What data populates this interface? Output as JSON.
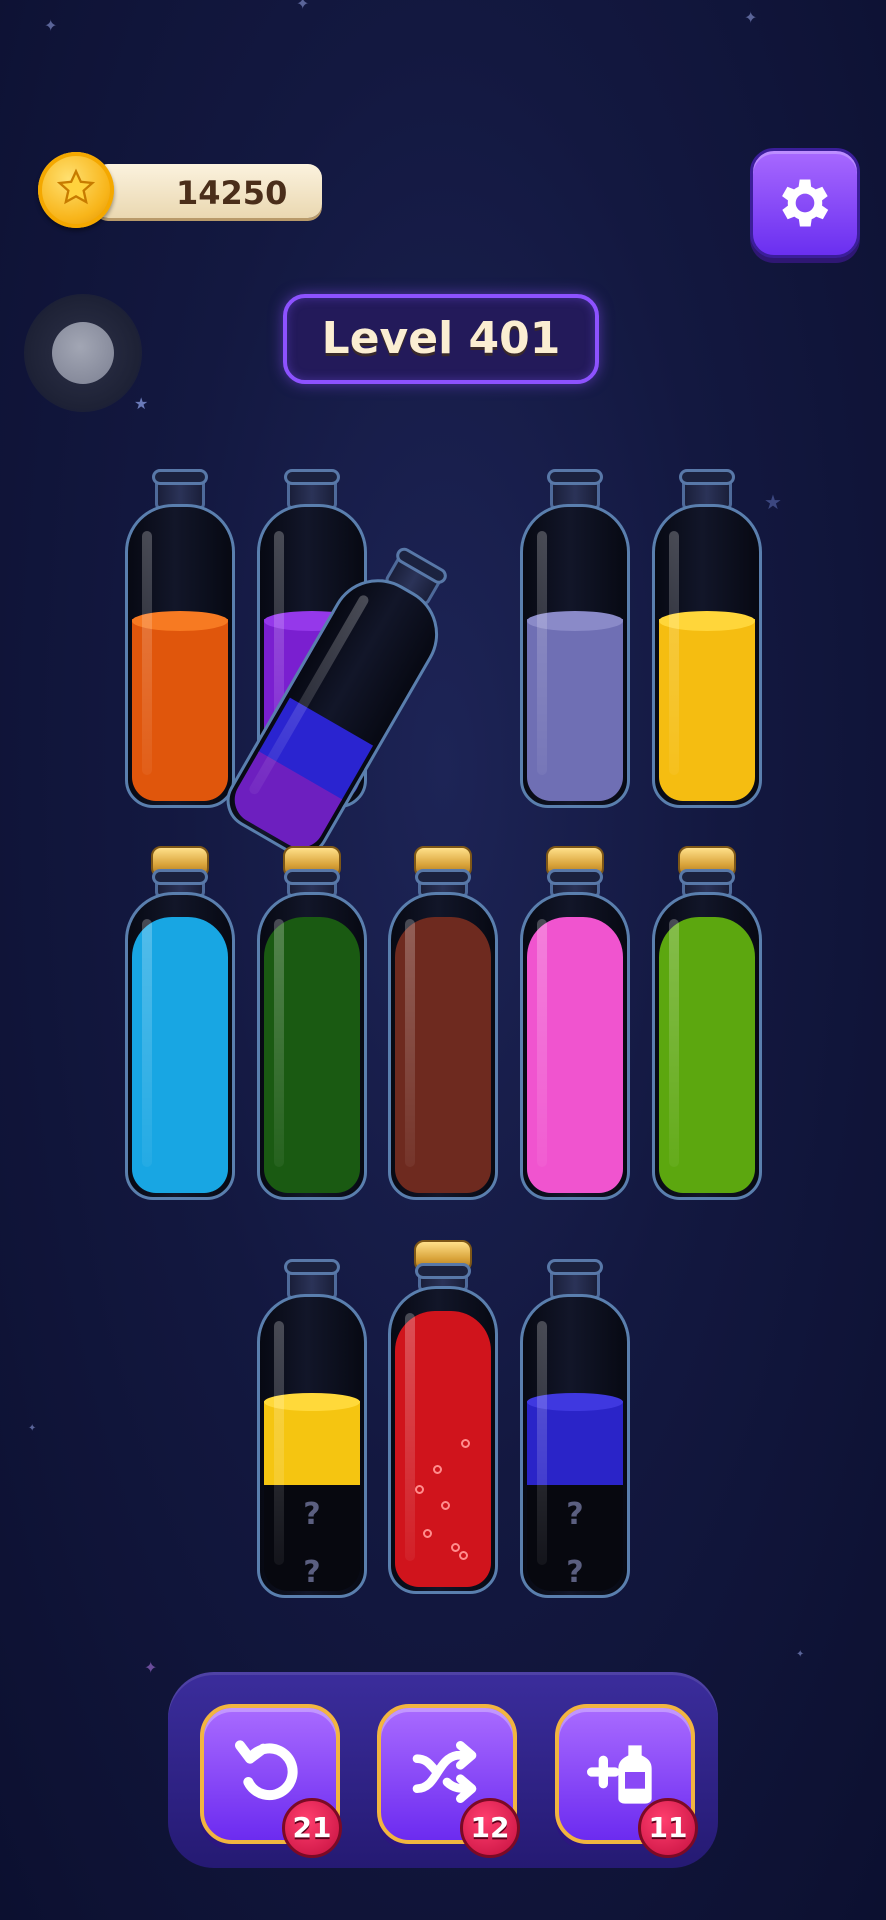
{
  "coins": {
    "value": "14250",
    "icon": "star-coin-icon"
  },
  "level": {
    "label": "Level 401"
  },
  "settings": {
    "icon": "gear-icon"
  },
  "bottles": {
    "row1": [
      {
        "name": "bottle-orange",
        "layers": [
          {
            "color": "#e0560c"
          }
        ]
      },
      {
        "name": "bottle-purple-blue",
        "layers": [
          {
            "color": "#7a1fd0"
          },
          {
            "color": "#2a24d0"
          }
        ]
      },
      {
        "name": "bottle-lavender",
        "layers": [
          {
            "color": "#6f6fb4"
          }
        ]
      },
      {
        "name": "bottle-yellow",
        "layers": [
          {
            "color": "#f5bd11"
          }
        ]
      }
    ],
    "tilted": {
      "name": "bottle-tilted",
      "layers": [
        {
          "color": "#2a24d0"
        },
        {
          "color": "#6d1fbf"
        }
      ]
    },
    "row2": [
      {
        "name": "bottle-cyan",
        "color": "#18a6e3",
        "corked": true
      },
      {
        "name": "bottle-green",
        "color": "#1a5a12",
        "corked": true
      },
      {
        "name": "bottle-brown",
        "color": "#6e2a1f",
        "corked": true
      },
      {
        "name": "bottle-pink",
        "color": "#f054cf",
        "corked": true
      },
      {
        "name": "bottle-lime",
        "color": "#5ca70f",
        "corked": true
      }
    ],
    "row3": [
      {
        "name": "bottle-yellow-hidden",
        "top_color": "#f5c511",
        "hidden": [
          "?",
          "?"
        ]
      },
      {
        "name": "bottle-red",
        "color": "#d0141c",
        "corked": true
      },
      {
        "name": "bottle-blue-hidden",
        "top_color": "#2a24c8",
        "hidden": [
          "?",
          "?"
        ]
      }
    ]
  },
  "tools": [
    {
      "name": "undo-button",
      "icon": "undo-icon",
      "count": "21"
    },
    {
      "name": "shuffle-button",
      "icon": "shuffle-icon",
      "count": "12"
    },
    {
      "name": "add-bottle-button",
      "icon": "add-bottle-icon",
      "count": "11"
    }
  ]
}
